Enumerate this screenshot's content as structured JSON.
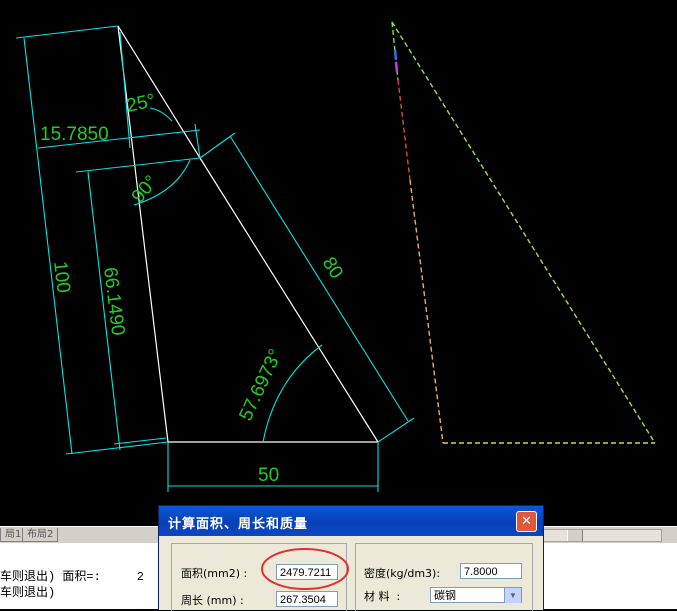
{
  "drawing": {
    "dim_top_offset": "15.7850",
    "dim_angle_top": "25°",
    "dim_angle_right": "90°",
    "dim_left_height": "100",
    "dim_inner_height": "66.1490",
    "dim_slant": "80",
    "dim_angle_bottom": "57.6973°",
    "dim_base": "50"
  },
  "tabs": [
    {
      "label": "局1"
    },
    {
      "label": "布局2"
    }
  ],
  "command": {
    "line1": "车则退出) 面积=:     2",
    "line2": "车则退出)"
  },
  "dialog": {
    "title": "计算面积、周长和质量",
    "area_label": "面积(mm2) :",
    "area_value": "2479.7211",
    "perimeter_label": "周长 (mm) :",
    "perimeter_value": "267.3504",
    "density_label": "密度(kg/dm3):",
    "density_value": "7.8000",
    "material_label": "材 料  :",
    "material_value": "碳钢"
  },
  "colors": {
    "background": "#000000",
    "geometry": "#ffffff",
    "dimension_line": "#00e5e5",
    "dimension_text": "#22cc22",
    "highlight_circle": "#e03030"
  }
}
